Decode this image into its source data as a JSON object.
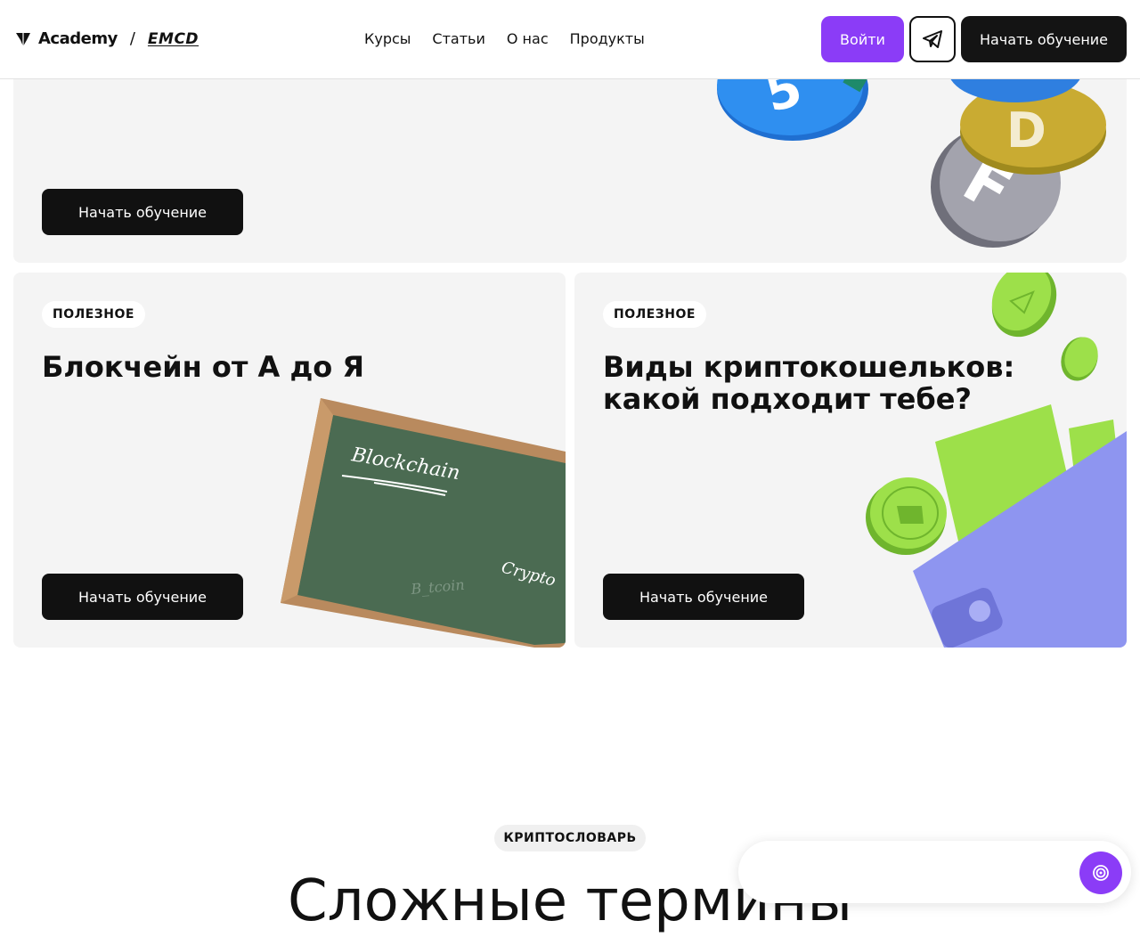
{
  "header": {
    "logo_text": "Academy",
    "logo_separator": "/",
    "logo_partner": "EMCD",
    "nav": [
      "Курсы",
      "Статьи",
      "О нас",
      "Продукты"
    ],
    "login_label": "Войти",
    "start_label": "Начать обучение",
    "accent_color": "#8b3cf7"
  },
  "cards": [
    {
      "button_label": "Начать обучение"
    },
    {
      "badge": "ПОЛЕЗНОЕ",
      "title": "Блокчейн от А до Я",
      "button_label": "Начать обучение",
      "board_words": [
        "Blockchain",
        "Crypto",
        "B_tcoin"
      ]
    },
    {
      "badge": "ПОЛЕЗНОЕ",
      "title_line1": "Виды криптокошельков:",
      "title_line2": "какой подходит тебе?",
      "button_label": "Начать обучение"
    }
  ],
  "dictionary": {
    "badge": "КРИПТОСЛОВАРЬ",
    "title": "Сложные термины"
  },
  "icons": [
    "logo-mark-icon",
    "telegram-icon",
    "chat-target-icon"
  ]
}
